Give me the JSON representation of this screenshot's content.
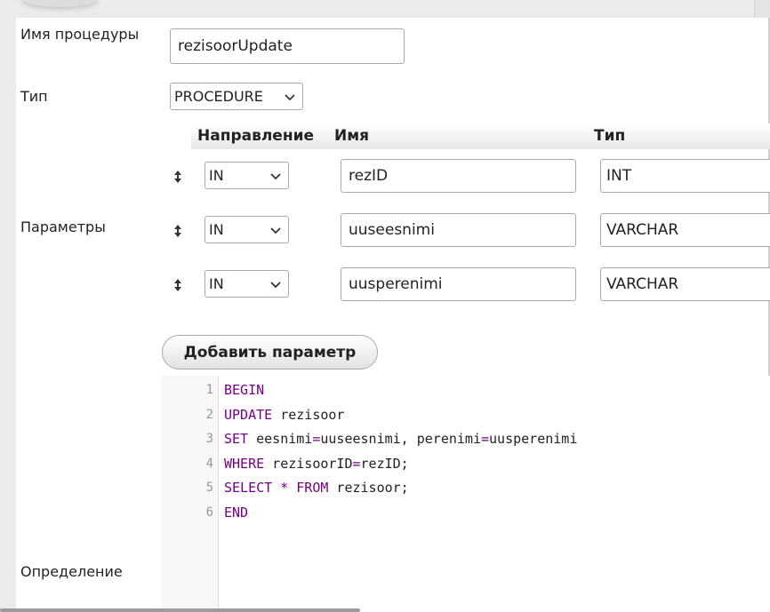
{
  "form": {
    "name_label": "Имя процедуры",
    "name_value": "rezisoorUpdate",
    "type_label": "Тип",
    "type_value": "PROCEDURE",
    "params_label": "Параметры",
    "definition_label": "Определение"
  },
  "params_table": {
    "headers": [
      "Направление",
      "Имя",
      "Тип"
    ],
    "rows": [
      {
        "direction": "IN",
        "name": "rezID",
        "type": "INT"
      },
      {
        "direction": "IN",
        "name": "uuseesnimi",
        "type": "VARCHAR"
      },
      {
        "direction": "IN",
        "name": "uusperenimi",
        "type": "VARCHAR"
      }
    ]
  },
  "add_param_label": "Добавить параметр",
  "editor": {
    "line_numbers": [
      "1",
      "2",
      "3",
      "4",
      "5",
      "6"
    ],
    "lines": [
      [
        {
          "t": "BEGIN",
          "c": "kw"
        }
      ],
      [
        {
          "t": "UPDATE",
          "c": "kw"
        },
        {
          "t": " rezisoor",
          "c": ""
        }
      ],
      [
        {
          "t": "SET",
          "c": "kw"
        },
        {
          "t": " eesnimi",
          "c": ""
        },
        {
          "t": "=",
          "c": "kw"
        },
        {
          "t": "uuseesnimi, perenimi",
          "c": ""
        },
        {
          "t": "=",
          "c": "kw"
        },
        {
          "t": "uusperenimi",
          "c": ""
        }
      ],
      [
        {
          "t": "WHERE",
          "c": "kw"
        },
        {
          "t": " rezisoorID",
          "c": ""
        },
        {
          "t": "=",
          "c": "kw"
        },
        {
          "t": "rezID;",
          "c": ""
        }
      ],
      [
        {
          "t": "SELECT",
          "c": "kw"
        },
        {
          "t": " ",
          "c": ""
        },
        {
          "t": "*",
          "c": "kw"
        },
        {
          "t": " ",
          "c": ""
        },
        {
          "t": "FROM",
          "c": "kw"
        },
        {
          "t": " rezisoor;",
          "c": ""
        }
      ],
      [
        {
          "t": "END",
          "c": "kw"
        }
      ]
    ]
  },
  "icons": {
    "drag_handle": "drag-handle-icon",
    "select_arrow": "chevron-down-icon"
  },
  "colors": {
    "keyword": "#770088",
    "gutter_text": "#999999"
  }
}
